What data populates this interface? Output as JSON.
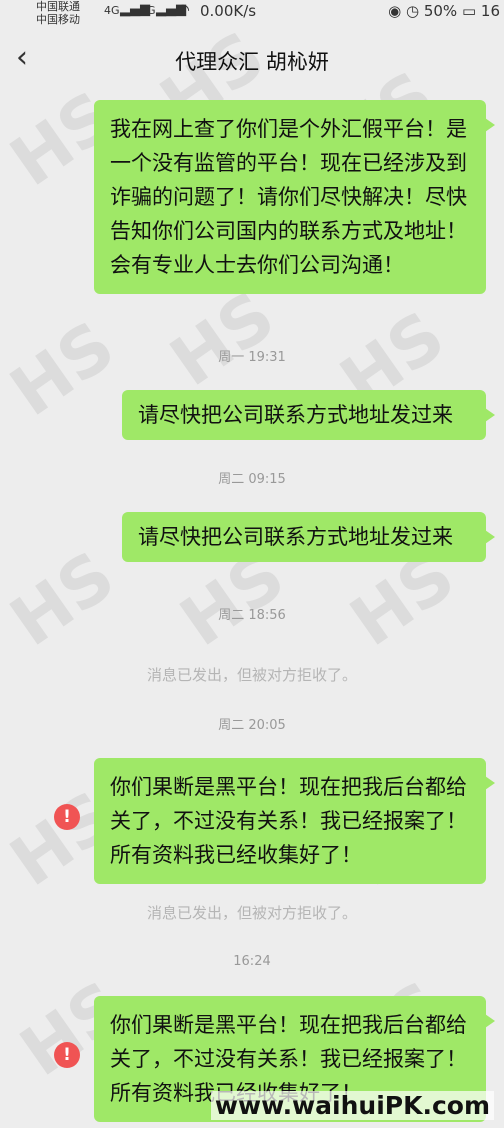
{
  "status": {
    "carrier_line1": "中国联通",
    "carrier_line2": "中国移动",
    "network_a": "4G",
    "network_b": "4G",
    "speed": "0.00K/s",
    "battery": "50%",
    "time": "16"
  },
  "header": {
    "title": "代理众汇  胡杺妍"
  },
  "messages": [
    {
      "text": "我在网上查了你们是个外汇假平台！是一个没有监管的平台！现在已经涉及到诈骗的问题了！请你们尽快解决！尽快告知你们公司国内的联系方式及地址！会有专业人士去你们公司沟通！"
    },
    {
      "text": "请尽快把公司联系方式地址发过来"
    },
    {
      "text": "请尽快把公司联系方式地址发过来"
    },
    {
      "text": "你们果断是黑平台！现在把我后台都给关了，不过没有关系！我已经报案了！所有资料我已经收集好了！"
    },
    {
      "text": "你们果断是黑平台！现在把我后台都给关了，不过没有关系！我已经报案了！所有资料我已经收集好了！"
    }
  ],
  "times": [
    "周一 19:31",
    "周二 09:15",
    "周二 18:56",
    "周二 20:05",
    "16:24"
  ],
  "notices": [
    "消息已发出，但被对方拒收了。",
    "消息已发出，但被对方拒收了。"
  ],
  "error_mark": "!",
  "watermark": {
    "text": "HS",
    "site": "www.waihuiPK.com"
  }
}
